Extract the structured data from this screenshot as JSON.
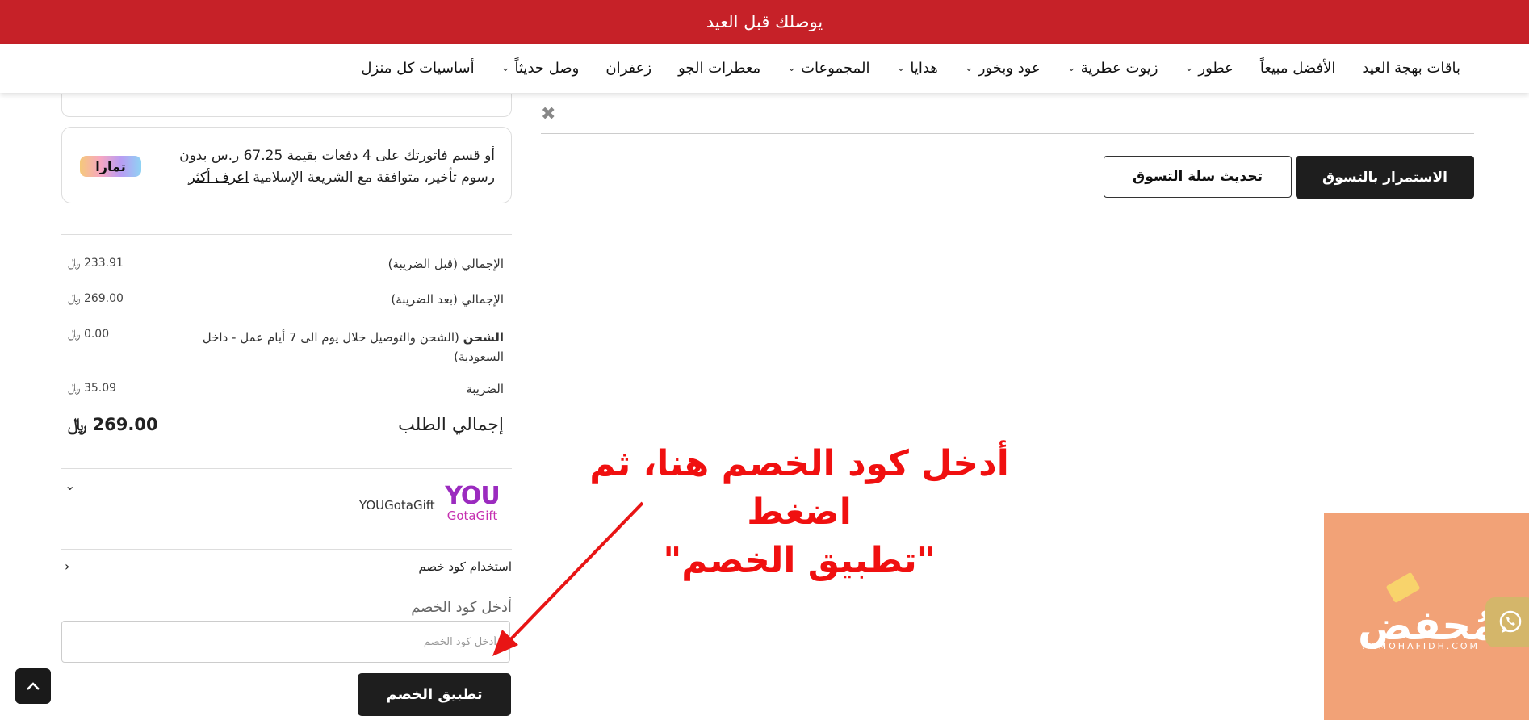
{
  "announcement": "يوصلك قبل العيد",
  "nav": [
    {
      "label": "باقات بهجة العيد",
      "dropdown": false
    },
    {
      "label": "الأفضل مبيعاً",
      "dropdown": false
    },
    {
      "label": "عطور",
      "dropdown": true
    },
    {
      "label": "زيوت عطرية",
      "dropdown": true
    },
    {
      "label": "عود وبخور",
      "dropdown": true
    },
    {
      "label": "هدايا",
      "dropdown": true
    },
    {
      "label": "المجموعات",
      "dropdown": true
    },
    {
      "label": "معطرات الجو",
      "dropdown": false
    },
    {
      "label": "زعفران",
      "dropdown": false
    },
    {
      "label": "وصل حديثاً",
      "dropdown": true
    },
    {
      "label": "أساسيات كل منزل",
      "dropdown": false
    }
  ],
  "tamara": {
    "text": "أو قسم فاتورتك على 4 دفعات بقيمة 67.25 ر.س بدون رسوم تأخير، متوافقة مع الشريعة الإسلامية",
    "link": "اعرف أكثر",
    "logo": "تمارا"
  },
  "summary": {
    "subtotal_label": "الإجمالي (قبل الضريبة)",
    "subtotal_value": "233.91 ﷼",
    "total_incl_label": "الإجمالي (بعد الضريبة)",
    "total_incl_value": "269.00 ﷼",
    "shipping_bold": "الشحن",
    "shipping_label": " (الشحن والتوصيل خلال يوم الى 7 أيام عمل - داخل السعودية)",
    "shipping_value": "0.00 ﷼",
    "tax_label": "الضريبة",
    "tax_value": "35.09 ﷼",
    "order_total_label": "إجمالي الطلب",
    "order_total_value": "269.00 ﷼"
  },
  "gift": {
    "logo_top": "YOU",
    "logo_bottom": "GotaGift",
    "name": "YOUGotaGift"
  },
  "coupon": {
    "toggle_label": "استخدام كود خصم",
    "field_label": "أدخل كود الخصم",
    "placeholder": "أدخل كود الخصم",
    "apply_label": "تطبيق الخصم"
  },
  "cart_actions": {
    "continue_label": "الاستمرار بالتسوق",
    "update_label": "تحديث سلة التسوق"
  },
  "annotation": {
    "line1": "أدخل كود الخصم هنا، ثم اضغط",
    "line2": "\"تطبيق الخصم\""
  },
  "watermark": {
    "text": "المُحفض",
    "sub": "ALMOHAFIDH.COM"
  },
  "icons": {
    "close": "close-icon",
    "scroll_top": "chevron-up-icon",
    "whatsapp": "whatsapp-icon"
  }
}
